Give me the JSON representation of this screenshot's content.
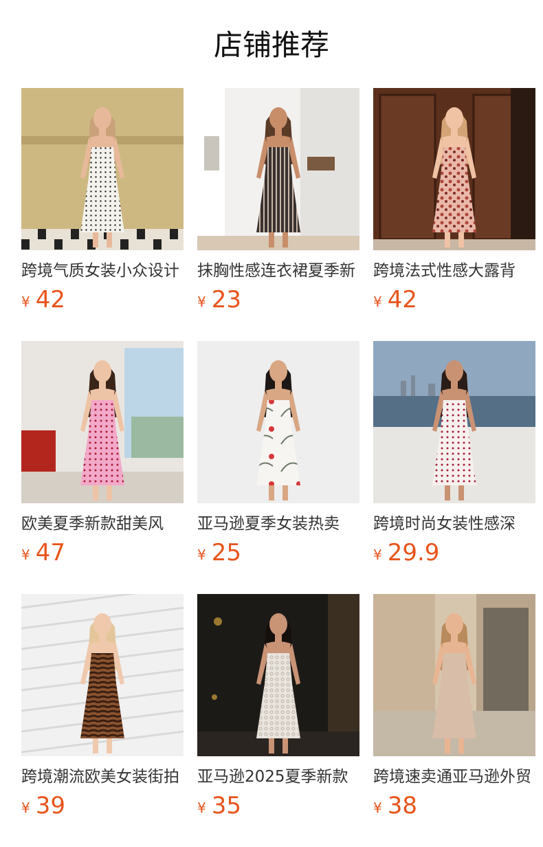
{
  "section_title": "店铺推荐",
  "currency": "¥",
  "products": [
    {
      "name": "跨境气质女装小众设计",
      "price": "42",
      "scene": "cream-wall",
      "dress": "#f4f2ec",
      "pattern": "dots-black",
      "skin": "#e7b99a",
      "hair": "#c9a27a"
    },
    {
      "name": "抹胸性感连衣裙夏季新",
      "price": "23",
      "scene": "white-room",
      "dress": "#3a3230",
      "pattern": "stripes",
      "skin": "#c88e6a",
      "hair": "#5a3b28"
    },
    {
      "name": "跨境法式性感大露背",
      "price": "42",
      "scene": "wood-door",
      "dress": "#e9b8a8",
      "pattern": "leopard",
      "skin": "#f0c3a5",
      "hair": "#d4a376"
    },
    {
      "name": "欧美夏季新款甜美风",
      "price": "47",
      "scene": "apartment",
      "dress": "#f3a9c9",
      "pattern": "dots-red",
      "skin": "#eec4a6",
      "hair": "#3b2418"
    },
    {
      "name": "亚马逊夏季女装热卖",
      "price": "25",
      "scene": "studio",
      "dress": "#f7f5f2",
      "pattern": "print",
      "skin": "#d9a784",
      "hair": "#1d1715"
    },
    {
      "name": "跨境时尚女装性感深",
      "price": "29.9",
      "scene": "seaside",
      "dress": "#f6f1ee",
      "pattern": "dots-red",
      "skin": "#c99273",
      "hair": "#2a1c16"
    },
    {
      "name": "跨境潮流欧美女装街拍",
      "price": "39",
      "scene": "white-panel",
      "dress": "#8a5330",
      "pattern": "zebra",
      "skin": "#f0c9ad",
      "hair": "#e3c79b"
    },
    {
      "name": "亚马逊2025夏季新款",
      "price": "35",
      "scene": "night-city",
      "dress": "#e9e4dd",
      "pattern": "lace",
      "skin": "#c99376",
      "hair": "#16100d"
    },
    {
      "name": "跨境速卖通亚马逊外贸",
      "price": "38",
      "scene": "street",
      "dress": "#d8bda8",
      "pattern": "plain",
      "skin": "#e8b592",
      "hair": "#b88a5c"
    }
  ]
}
